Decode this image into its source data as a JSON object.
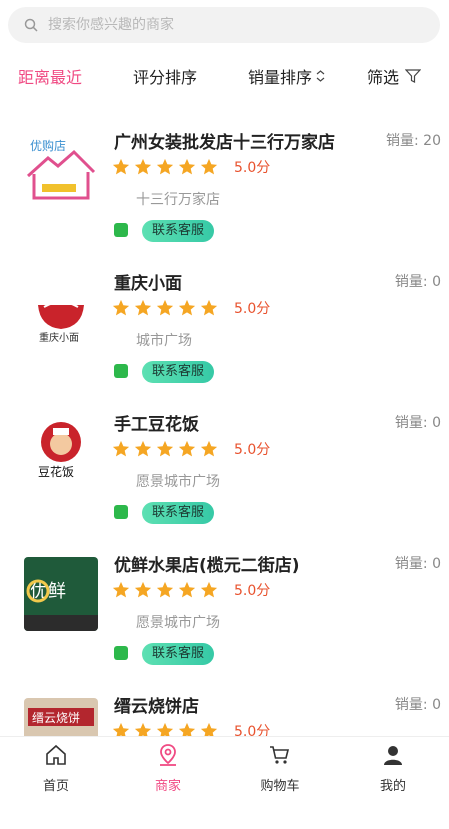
{
  "search": {
    "placeholder": "搜索你感兴趣的商家"
  },
  "sort": {
    "distance": "距离最近",
    "rating": "评分排序",
    "sales": "销量排序",
    "filter": "筛选"
  },
  "shops": [
    {
      "name": "广州女装批发店十三行万家店",
      "sales": "销量: 20",
      "score": "5.0分",
      "rating": 5,
      "address": "十三行万家店",
      "contact": "联系客服",
      "logo": "shop-house-logo"
    },
    {
      "name": "重庆小面",
      "sales": "销量: 0",
      "score": "5.0分",
      "rating": 5,
      "address": "城市广场",
      "contact": "联系客服",
      "logo": "noodle-bowl-logo"
    },
    {
      "name": "手工豆花饭",
      "sales": "销量: 0",
      "score": "5.0分",
      "rating": 5,
      "address": "愿景城市广场",
      "contact": "联系客服",
      "logo": "chef-logo"
    },
    {
      "name": "优鲜水果店(榄元二街店)",
      "sales": "销量: 0",
      "score": "5.0分",
      "rating": 5,
      "address": "愿景城市广场",
      "contact": "联系客服",
      "logo": "fruit-shop-photo"
    },
    {
      "name": "缙云烧饼店",
      "sales": "销量: 0",
      "score": "5.0分",
      "rating": 5,
      "address": "",
      "contact": "",
      "logo": "bakery-shop-photo"
    }
  ],
  "tabbar": {
    "home": "首页",
    "shops": "商家",
    "cart": "购物车",
    "mine": "我的"
  },
  "colors": {
    "accent": "#f04a83",
    "star": "#f5a623",
    "score": "#e8522e",
    "contact": "#3fd0a8"
  }
}
